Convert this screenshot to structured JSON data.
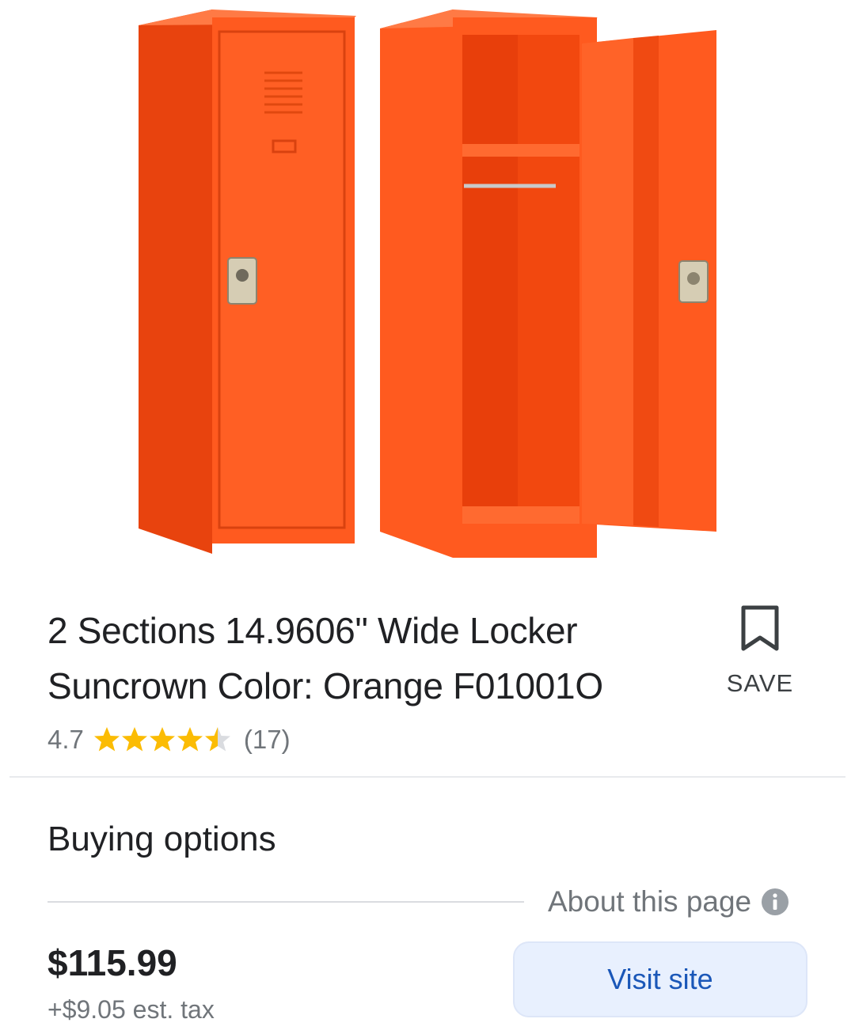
{
  "product": {
    "image_alt": "Two orange metal lockers, one closed and one open",
    "title": "2 Sections 14.9606\" Wide Locker Suncrown Color: Orange F01001O",
    "rating": "4.7",
    "rating_stars": 4.5,
    "reviews": "(17)"
  },
  "save": {
    "label": "SAVE",
    "icon": "bookmark-icon"
  },
  "buying": {
    "heading": "Buying options",
    "about_label": "About this page",
    "about_icon": "info-icon",
    "price": "$115.99",
    "tax": "+$9.05 est. tax",
    "visit_label": "Visit site"
  },
  "colors": {
    "locker": "#ff5a1f",
    "star": "#fbbc04",
    "button_bg": "#e8f0fe",
    "button_text": "#1a57b8"
  }
}
